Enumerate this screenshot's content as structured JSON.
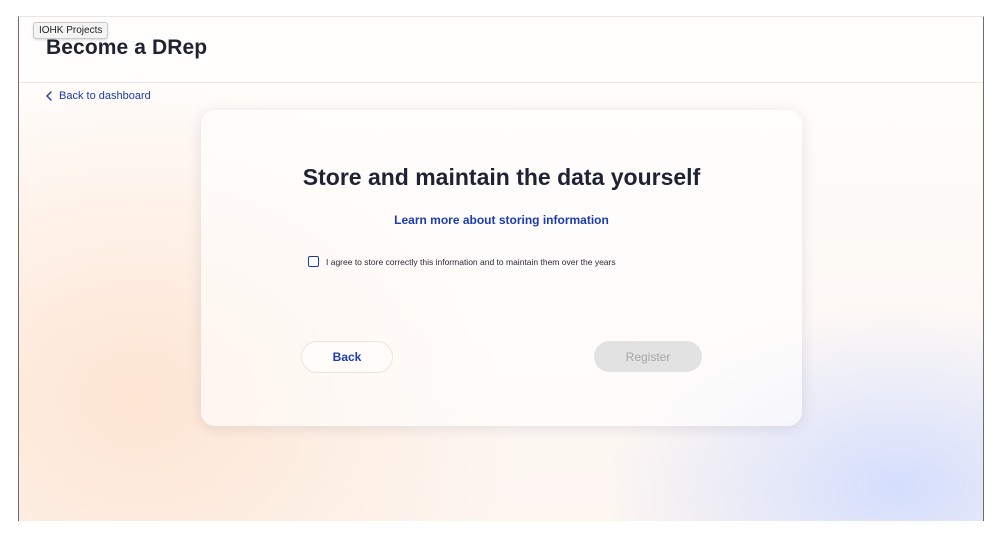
{
  "tooltip": {
    "text": "IOHK Projects"
  },
  "header": {
    "title": "Become a DRep"
  },
  "nav": {
    "back_label": "Back to dashboard"
  },
  "card": {
    "title": "Store and maintain the data yourself",
    "learn_more": "Learn more about storing information",
    "agree_label": "I agree to store correctly this information and to maintain them over the years",
    "agree_checked": false,
    "back_button": "Back",
    "register_button": "Register",
    "register_disabled": true
  },
  "icons": {
    "back": "chevron-left-icon",
    "checkbox": "checkbox-unchecked"
  },
  "colors": {
    "accent": "#1b3bb0",
    "text": "#1f2233",
    "disabled_bg": "#e2e2e2",
    "disabled_text": "#a6a6a6"
  }
}
